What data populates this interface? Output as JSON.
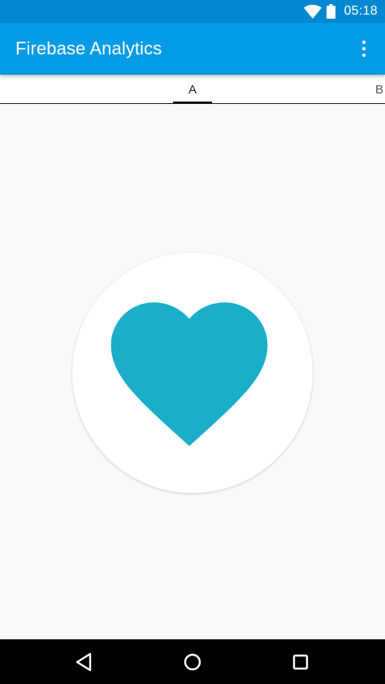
{
  "status_bar": {
    "time": "05:18",
    "icons": [
      "wifi-icon",
      "battery-icon"
    ],
    "color": "#0288d1"
  },
  "app_bar": {
    "title": "Firebase Analytics",
    "menu_icon": "overflow-menu-icon",
    "color": "#039be5"
  },
  "tabs": [
    {
      "label": "A",
      "selected": true
    },
    {
      "label": "B",
      "selected": false
    }
  ],
  "content": {
    "image_icon": "heart-icon",
    "heart_color": "#1aaec9"
  },
  "nav_bar": {
    "buttons": [
      "back-icon",
      "home-icon",
      "recents-icon"
    ]
  }
}
